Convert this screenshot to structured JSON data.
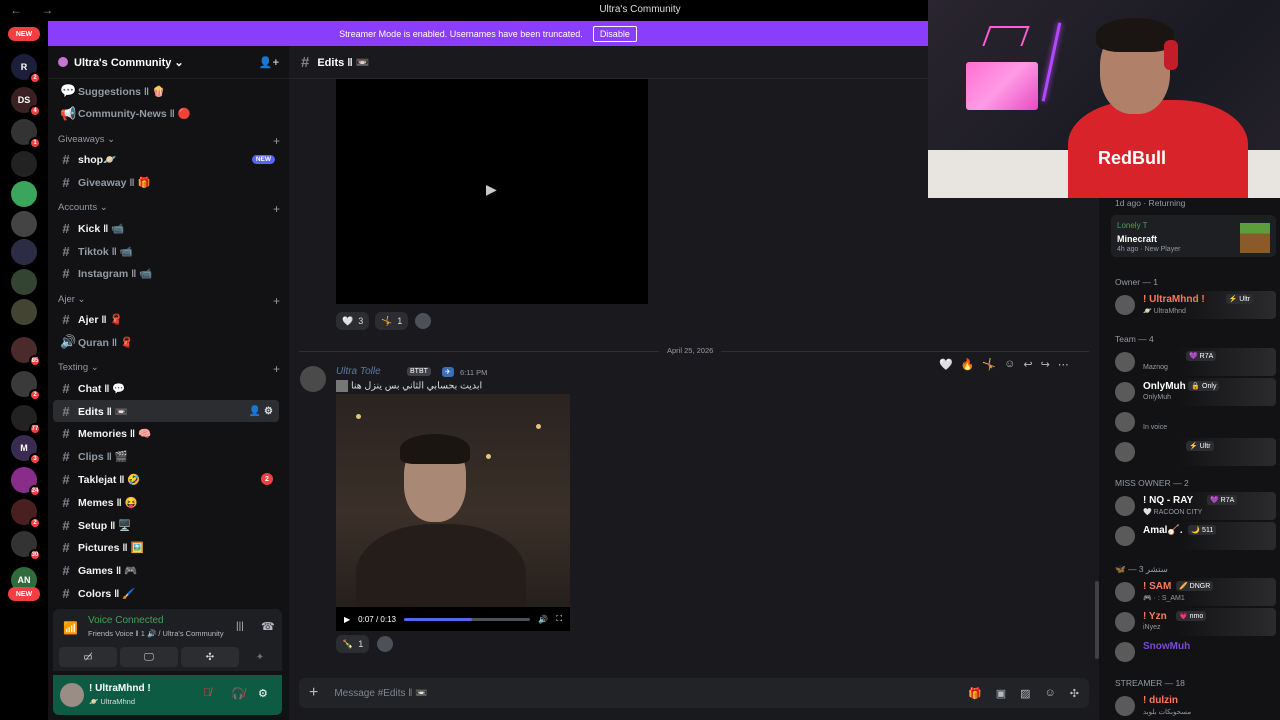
{
  "window": {
    "title": "Ultra's Community",
    "nav": "← →"
  },
  "banner": {
    "text": "Streamer Mode is enabled. Usernames have been truncated.",
    "button": "Disable"
  },
  "servers": [
    {
      "label": "NEW",
      "kind": "pill"
    },
    {
      "label": "R",
      "badge": "2"
    },
    {
      "label": "DS",
      "badge": "4"
    },
    {
      "label": "",
      "badge": "1"
    },
    {
      "label": "",
      "badge": ""
    },
    {
      "label": "",
      "badge": ""
    },
    {
      "label": "",
      "badge": ""
    },
    {
      "label": "",
      "badge": ""
    },
    {
      "label": "",
      "badge": ""
    },
    {
      "label": "",
      "badge": ""
    },
    {
      "label": "",
      "badge": "85"
    },
    {
      "label": "",
      "badge": "2"
    },
    {
      "label": "",
      "badge": "77"
    },
    {
      "label": "M",
      "badge": "3"
    },
    {
      "label": "",
      "badge": "24"
    },
    {
      "label": "",
      "badge": "2"
    },
    {
      "label": "",
      "badge": "30"
    },
    {
      "label": "AN",
      "badge": ""
    },
    {
      "label": "NEW",
      "kind": "pill"
    }
  ],
  "guild": {
    "name": "Ultra's Community ⌄"
  },
  "channels": [
    {
      "type": "chan",
      "icon": "💬",
      "label": "Suggestions ‖ 🍿"
    },
    {
      "type": "chan",
      "icon": "📢",
      "label": "Community-News ‖ 🔴"
    },
    {
      "type": "cat",
      "label": "Giveaways ⌄"
    },
    {
      "type": "chan",
      "icon": "#",
      "label": "shop🪐",
      "bright": true,
      "badge_new": "NEW"
    },
    {
      "type": "chan",
      "icon": "#",
      "label": "Giveaway ‖ 🎁"
    },
    {
      "type": "cat",
      "label": "Accounts ⌄"
    },
    {
      "type": "chan",
      "icon": "#",
      "label": "Kick ‖ 📹",
      "bright": true
    },
    {
      "type": "chan",
      "icon": "#",
      "label": "Tiktok ‖ 📹"
    },
    {
      "type": "chan",
      "icon": "#",
      "label": "Instagram ‖ 📹"
    },
    {
      "type": "cat",
      "label": "Ajer ⌄"
    },
    {
      "type": "chan",
      "icon": "#",
      "label": "Ajer ‖ 🧣",
      "bright": true
    },
    {
      "type": "chan",
      "icon": "🔊",
      "label": "Quran ‖ 🧣"
    },
    {
      "type": "cat",
      "label": "Texting ⌄"
    },
    {
      "type": "chan",
      "icon": "#",
      "label": "Chat ‖ 💬",
      "bright": true
    },
    {
      "type": "chan",
      "icon": "#",
      "label": "Edits ‖ 📼",
      "active": true
    },
    {
      "type": "chan",
      "icon": "#",
      "label": "Memories ‖ 🧠",
      "bright": true
    },
    {
      "type": "chan",
      "icon": "#",
      "label": "Clips ‖ 🎬"
    },
    {
      "type": "chan",
      "icon": "#",
      "label": "Taklejat ‖ 🤣",
      "bright": true,
      "badge_num": "2"
    },
    {
      "type": "chan",
      "icon": "#",
      "label": "Memes ‖ 😝",
      "bright": true
    },
    {
      "type": "chan",
      "icon": "#",
      "label": "Setup ‖ 🖥️",
      "bright": true
    },
    {
      "type": "chan",
      "icon": "#",
      "label": "Pictures ‖ 🖼️",
      "bright": true
    },
    {
      "type": "chan",
      "icon": "#",
      "label": "Games ‖ 🎮",
      "bright": true
    },
    {
      "type": "chan",
      "icon": "#",
      "label": "Colors ‖ 🖌️",
      "bright": true
    }
  ],
  "voice": {
    "status": "Voice Connected",
    "detail": "Friends Voice ‖ 1 🔊 / Ultra's Community"
  },
  "user": {
    "name": "! UltraMhnd !",
    "status": "🪐 UltraMhnd"
  },
  "chat": {
    "channel": "Edits ‖ 📼",
    "reactions_top": [
      {
        "emoji": "🤍",
        "count": "3"
      },
      {
        "emoji": "🤸",
        "count": "1"
      }
    ],
    "date": "April 25, 2026",
    "message": {
      "author": "Ultra Tolle",
      "tag1": "BTBT",
      "time": "6:11 PM",
      "text": "ابديت بحسابي الثاني بس ينزل هنا"
    },
    "video_time": "0:07 / 0:13",
    "video_progress": 0.54,
    "reactions_bottom": [
      {
        "emoji": "🍾",
        "count": "1"
      }
    ],
    "composer_placeholder": "Message #Edits ‖ 📼"
  },
  "members": {
    "activity_top": "1d ago · Returning",
    "activity": {
      "user": "Lonely T",
      "game": "Minecraft",
      "meta": "4h ago · New Player"
    },
    "groups": [
      {
        "title": "Owner — 1",
        "items": [
          {
            "name": "! UltraMhnd !",
            "tag": "⚡ Ultr",
            "sub": "🪐 UltraMhnd",
            "color": "#ff7a59"
          }
        ]
      },
      {
        "title": "Team — 4",
        "items": [
          {
            "name": "",
            "tag": "💜 R7A",
            "sub": "Maznog",
            "color": "#b47cff"
          },
          {
            "name": "OnlyMuh",
            "tag": "🔒 Only",
            "sub": "OnlyMuh",
            "color": "#ffffff"
          },
          {
            "name": "",
            "tag": "",
            "sub": "In voice",
            "color": "#ffffff"
          },
          {
            "name": "",
            "tag": "⚡ Ultr",
            "sub": "",
            "color": "#5865f2"
          }
        ]
      },
      {
        "title": "MISS OWNER — 2",
        "items": [
          {
            "name": "! NQ - RAY",
            "tag": "💜 R7A",
            "sub": "🤍 RACOON CITY",
            "color": "#ffffff"
          },
          {
            "name": "Amal🪕.",
            "tag": "🌙 511",
            "sub": "",
            "color": "#ffffff"
          }
        ]
      },
      {
        "title": "🦋 — ستشر 3",
        "items": [
          {
            "name": "! SAM",
            "tag": "🥖 DNGR",
            "sub": "🎮 · : S_AM1",
            "color": "#ff7a59"
          },
          {
            "name": "! Yzn",
            "tag": "💗 nmo",
            "sub": "iNyez",
            "color": "#ff7a59"
          },
          {
            "name": "SnowMuh",
            "tag": "",
            "sub": "",
            "color": "#7a4bd6"
          }
        ]
      },
      {
        "title": "STREAMER — 18",
        "items": [
          {
            "name": "! dulzin",
            "tag": "",
            "sub": "مسحوبكات بلوبد",
            "color": "#ff7a59"
          }
        ]
      }
    ]
  },
  "webcam": {
    "shirt_text": "RedBull"
  },
  "colors": {
    "accent": "#8b3dfc",
    "blurple": "#5865f2",
    "danger": "#f23f43",
    "online": "#43a25a"
  }
}
